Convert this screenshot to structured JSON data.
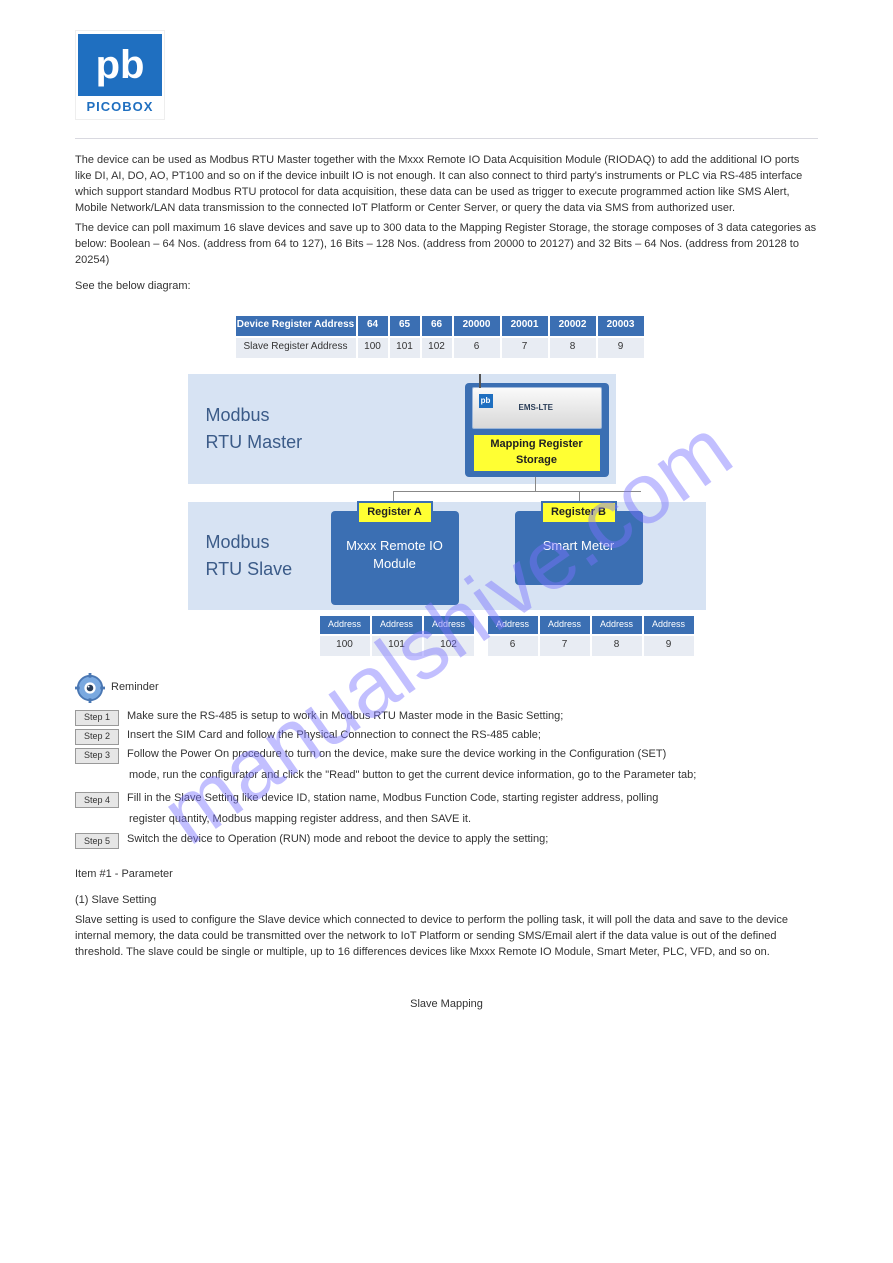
{
  "logo": {
    "mark": "pb",
    "brand": "PICOBOX"
  },
  "intro": {
    "p1": "The device can be used as Modbus RTU Master together with the Mxxx Remote IO Data Acquisition Module (RIODAQ) to add the additional IO ports like DI, AI, DO, AO, PT100 and so on if the device inbuilt IO is not enough. It can also connect to third party's instruments or PLC via RS-485 interface which support standard Modbus RTU protocol for data acquisition, these data can be used as trigger to execute programmed action like SMS Alert, Mobile Network/LAN data transmission to the connected IoT Platform or Center Server, or query the data via SMS from authorized user.",
    "p2": "The device can poll maximum 16 slave devices and save up to 300 data to the Mapping Register Storage, the storage composes of 3 data categories as below: Boolean – 64 Nos. (address from 64 to 127), 16 Bits – 128 Nos. (address from 20000 to 20127) and 32 Bits – 64 Nos. (address from 20128 to 20254)",
    "p3": "See the below diagram:"
  },
  "diagram": {
    "topTable": {
      "row1Label": "Device Register Address",
      "row1Vals": [
        "64",
        "65",
        "66",
        "20000",
        "20001",
        "20002",
        "20003"
      ],
      "row2Label": "Slave Register Address",
      "row2Vals": [
        "100",
        "101",
        "102",
        "6",
        "7",
        "8",
        "9"
      ]
    },
    "masterLabel1": "Modbus",
    "masterLabel2": "RTU Master",
    "slaveLabel1": "Modbus",
    "slaveLabel2": "RTU Slave",
    "deviceModel": "EMS-LTE",
    "mappingBox": "Mapping Register Storage",
    "regA": "Register A",
    "regB": "Register B",
    "unitA": "Mxxx Remote IO Module",
    "unitB": "Smart Meter",
    "addrHeader": "Address",
    "botA": [
      "100",
      "101",
      "102"
    ],
    "botB": [
      "6",
      "7",
      "8",
      "9"
    ]
  },
  "gearNote": "Reminder",
  "steps": {
    "s1": {
      "badge": "Step 1",
      "text": "Make sure the RS-485 is setup to work in Modbus RTU Master mode in the Basic Setting;"
    },
    "s2": {
      "badge": "Step 2",
      "text": "Insert the SIM Card and follow the Physical Connection to connect the RS-485 cable;"
    },
    "s3": {
      "badge": "Step 3",
      "text": "Follow the Power On procedure to turn on the device, make sure the device working in the Configuration (SET)"
    },
    "s3b": "mode, run the configurator and click the \"Read\" button to get the current device information, go to the Parameter tab;",
    "s4": {
      "badge": "Step 4",
      "text": "Fill in the Slave Setting like device ID, station name, Modbus Function Code, starting register address, polling"
    },
    "s4b": "register quantity, Modbus mapping register address, and then SAVE it.",
    "s5": {
      "badge": "Step 5",
      "text": "Switch the device to Operation (RUN) mode and reboot the device to apply the setting;"
    }
  },
  "item1": "Item #1 - Parameter",
  "slaveHead": "(1) Slave Setting",
  "slaveBody": "Slave setting is used to configure the Slave device which connected to device to perform the polling task, it will poll the data and save to the device internal memory, the data could be transmitted over the network to IoT Platform or sending SMS/Email alert if the data value is out of the defined threshold. The slave could be single or multiple, up to 16 differences devices like Mxxx Remote IO Module, Smart Meter, PLC, VFD, and so on.",
  "figure": "Slave Mapping"
}
